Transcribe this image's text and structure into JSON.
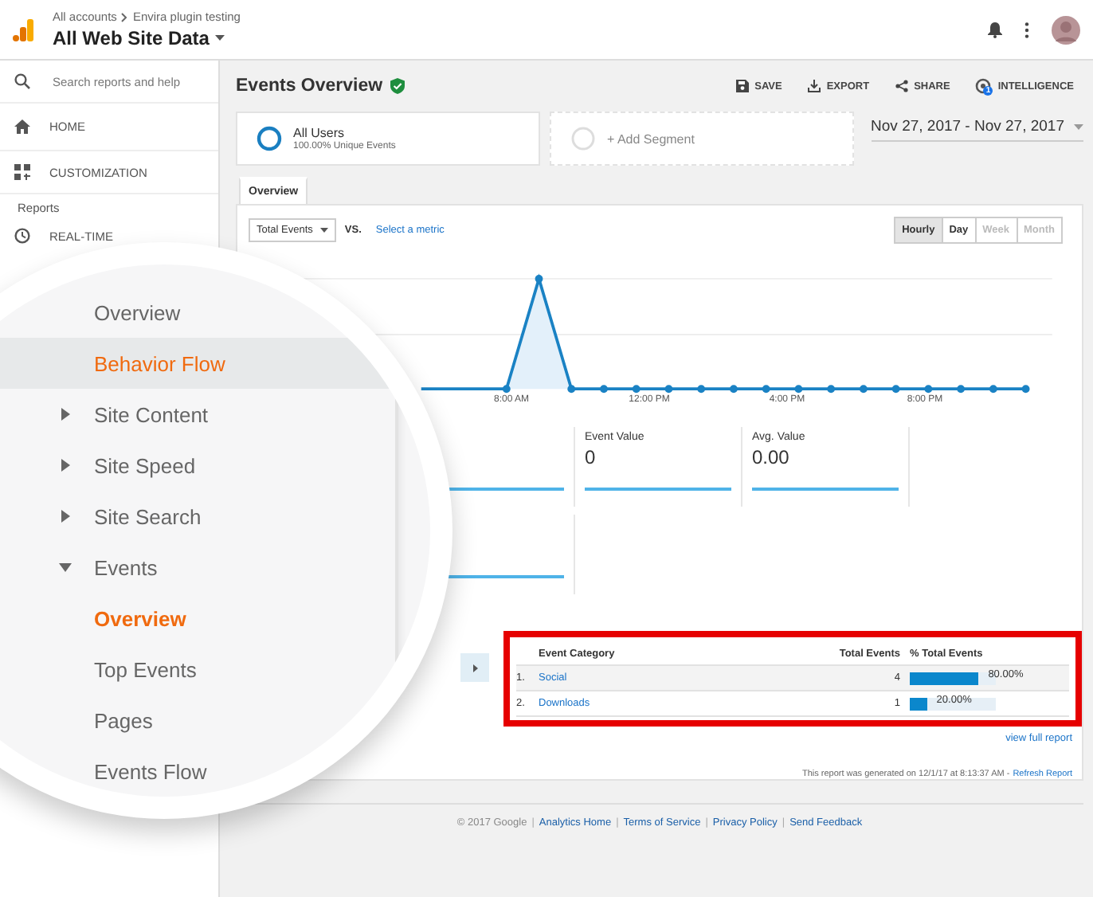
{
  "header": {
    "breadcrumb": [
      "All accounts",
      "Envira plugin testing"
    ],
    "property": "All Web Site Data"
  },
  "sidebar": {
    "search": {
      "placeholder": "Search reports and help"
    },
    "items": [
      {
        "label": "HOME"
      },
      {
        "label": "CUSTOMIZATION"
      }
    ],
    "section": "Reports",
    "report_items": [
      {
        "label": "REAL-TIME"
      }
    ]
  },
  "page": {
    "title": "Events Overview",
    "verified": true,
    "actions": [
      {
        "label": "SAVE"
      },
      {
        "label": "EXPORT"
      },
      {
        "label": "SHARE"
      },
      {
        "label": "INTELLIGENCE",
        "badge": "1"
      }
    ]
  },
  "segments": [
    {
      "kind": "segment",
      "name": "All Users",
      "detail": "100.00% Unique Events"
    },
    {
      "kind": "add",
      "name": "+ Add Segment"
    }
  ],
  "date_range": "Nov 27, 2017 - Nov 27, 2017",
  "tabs": [
    {
      "label": "Overview",
      "selected": true
    }
  ],
  "chart_controls": {
    "metric": "Total Events",
    "vs": "VS.",
    "compare": "Select a metric",
    "periods": [
      {
        "label": "Hourly",
        "selected": true,
        "disabled": false
      },
      {
        "label": "Day",
        "selected": false,
        "disabled": false
      },
      {
        "label": "Week",
        "selected": false,
        "disabled": true
      },
      {
        "label": "Month",
        "selected": false,
        "disabled": true
      }
    ]
  },
  "chart": {
    "x_labels": [
      "8:00 AM",
      "12:00 PM",
      "4:00 PM",
      "8:00 PM"
    ]
  },
  "metrics": [
    {
      "label": "Event Value",
      "value": "0"
    },
    {
      "label": "Avg. Value",
      "value": "0.00"
    }
  ],
  "table": {
    "columns": [
      "Event Category",
      "Total Events",
      "% Total Events"
    ],
    "rows": [
      {
        "rank": "1.",
        "category": "Social",
        "total": "4",
        "level": 0.8,
        "percent": "80.00%"
      },
      {
        "rank": "2.",
        "category": "Downloads",
        "total": "1",
        "level": 0.2,
        "percent": "20.00%"
      }
    ],
    "view_full": "view full report",
    "note": "This report was generated on 12/1/17 at 8:13:37 AM -",
    "refresh": "Refresh Report"
  },
  "footer": {
    "copyright": "© 2017 Google",
    "links": [
      {
        "separator": "|",
        "label": "Analytics Home"
      },
      {
        "separator": "|",
        "label": "Terms of Service"
      },
      {
        "separator": "|",
        "label": "Privacy Policy"
      },
      {
        "separator": "|",
        "label": "Send Feedback"
      }
    ]
  },
  "magnifier": {
    "items": [
      {
        "label": "Overview",
        "selected": false,
        "hovered": false
      },
      {
        "label": "Behavior Flow",
        "selected": true,
        "hovered": true
      },
      {
        "label": "Site Content",
        "selected": false,
        "hovered": false,
        "expanded": false
      },
      {
        "label": "Site Speed",
        "selected": false,
        "hovered": false,
        "expanded": false
      },
      {
        "label": "Site Search",
        "selected": false,
        "hovered": false,
        "expanded": false
      },
      {
        "label": "Events",
        "selected": false,
        "hovered": false,
        "expanded": true,
        "children": [
          {
            "label": "Overview",
            "selected": true,
            "hovered": false
          },
          {
            "label": "Top Events",
            "selected": false,
            "hovered": false
          },
          {
            "label": "Pages",
            "selected": false,
            "hovered": false
          },
          {
            "label": "Events Flow",
            "selected": false,
            "hovered": false
          }
        ]
      }
    ]
  }
}
